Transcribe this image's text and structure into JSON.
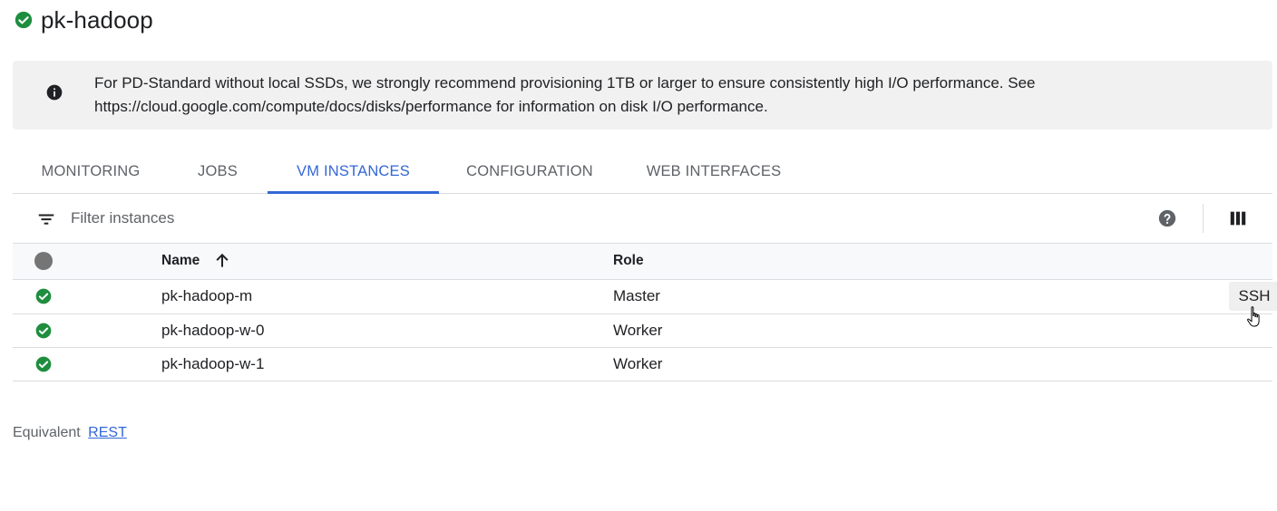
{
  "header": {
    "title": "pk-hadoop",
    "status_icon": "check-circle-icon",
    "status_color": "#1e8e3e"
  },
  "notice": {
    "icon": "info-icon",
    "line1": "For PD-Standard without local SSDs, we strongly recommend provisioning 1TB or larger to ensure consistently high I/O performance. See",
    "line2": "https://cloud.google.com/compute/docs/disks/performance for information on disk I/O performance."
  },
  "tabs": [
    {
      "label": "MONITORING",
      "active": false
    },
    {
      "label": "JOBS",
      "active": false
    },
    {
      "label": "VM INSTANCES",
      "active": true
    },
    {
      "label": "CONFIGURATION",
      "active": false
    },
    {
      "label": "WEB INTERFACES",
      "active": false
    }
  ],
  "filter": {
    "placeholder": "Filter instances",
    "value": "",
    "icon": "filter-list-icon",
    "help_icon": "help-icon",
    "columns_icon": "column-display-icon"
  },
  "table": {
    "columns": {
      "name": "Name",
      "role": "Role",
      "sort": "ascending"
    },
    "rows": [
      {
        "name": "pk-hadoop-m",
        "role": "Master",
        "status": "running",
        "action": "SSH"
      },
      {
        "name": "pk-hadoop-w-0",
        "role": "Worker",
        "status": "running"
      },
      {
        "name": "pk-hadoop-w-1",
        "role": "Worker",
        "status": "running"
      }
    ]
  },
  "footer": {
    "prefix": "Equivalent",
    "link": "REST"
  },
  "colors": {
    "accent": "#3367d6",
    "success": "#1e8e3e",
    "notice_bg": "#f1f1f1"
  }
}
